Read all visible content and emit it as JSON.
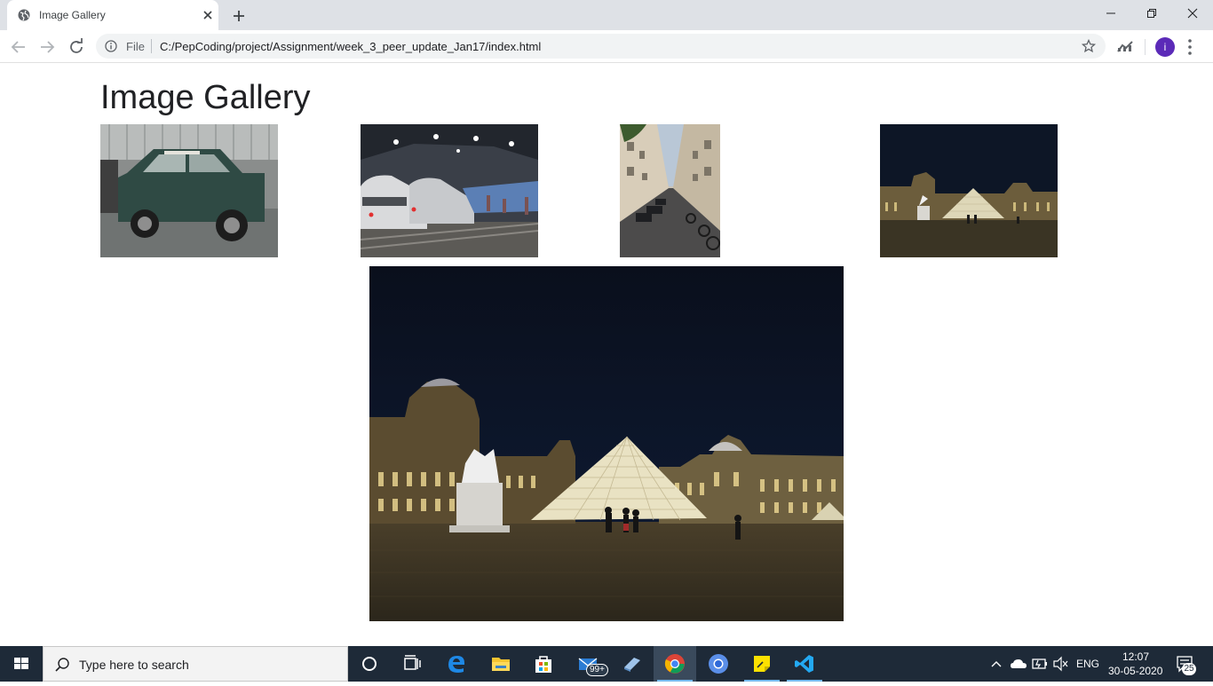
{
  "browser": {
    "tab": {
      "title": "Image Gallery"
    },
    "url": {
      "scheme": "File",
      "path": "C:/PepCoding/project/Assignment/week_3_peer_update_Jan17/index.html"
    },
    "profile_initial": "i"
  },
  "page": {
    "title": "Image Gallery",
    "thumbnails": [
      {
        "subject": "mini-car"
      },
      {
        "subject": "trains-station"
      },
      {
        "subject": "paris-street"
      },
      {
        "subject": "louvre-night"
      }
    ],
    "main_image": {
      "subject": "louvre-night"
    }
  },
  "taskbar": {
    "search_placeholder": "Type here to search",
    "mail_badge": "99+",
    "language": "ENG",
    "time": "12:07",
    "date": "30-05-2020",
    "notification_count": "25"
  },
  "colors": {
    "tab_strip": "#dee1e6",
    "omnibox": "#f1f3f4",
    "avatar": "#5b2ab8",
    "taskbar": "#1e2a38"
  }
}
